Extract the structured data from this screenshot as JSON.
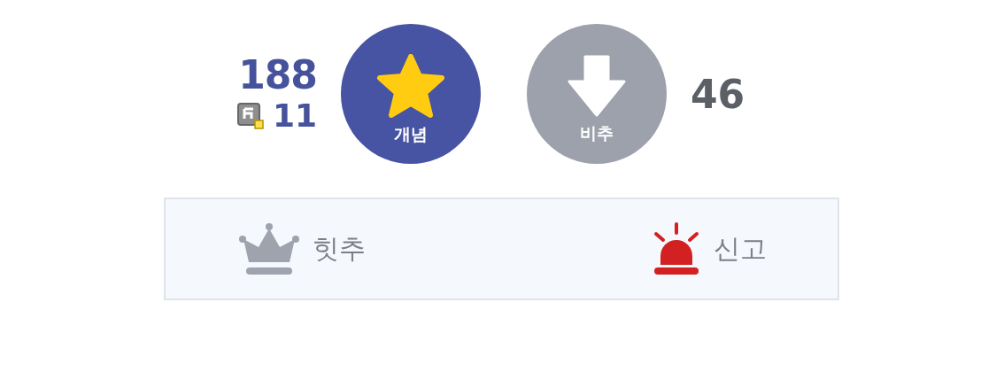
{
  "recommend": {
    "count": "188",
    "fixed_count": "11",
    "label": "개념"
  },
  "downvote": {
    "label": "비추",
    "count": "46"
  },
  "actions": [
    {
      "kind": "hit",
      "label": "힛추"
    },
    {
      "kind": "report",
      "label": "신고"
    }
  ]
}
